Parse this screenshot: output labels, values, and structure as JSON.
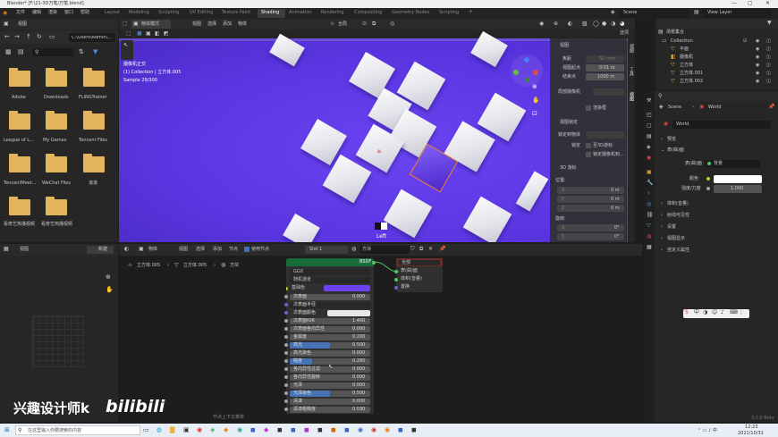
{
  "window": {
    "title": "Blender* [F:\\21-3D万笔/万笔.blend]"
  },
  "menu": [
    "文件",
    "编辑",
    "渲染",
    "窗口",
    "帮助"
  ],
  "workspaces": {
    "tabs": [
      "Layout",
      "Modeling",
      "Sculpting",
      "UV Editing",
      "Texture Paint",
      "Shading",
      "Animation",
      "Rendering",
      "Compositing",
      "Geometry Nodes",
      "Scripting"
    ],
    "active": "Shading",
    "plus": "+"
  },
  "topright": {
    "scene": "Scene",
    "view_layer": "View Layer"
  },
  "filebrowser": {
    "path": "C:\\Users\\Admin\\...",
    "view": "视图",
    "folders": [
      "Adobe",
      "Downloads",
      "FLiNGTrainer",
      "League of L...",
      "My Games",
      "Tencent Files",
      "TencentMeet...",
      "WeChat Files",
      "滚滚",
      "看奇艺热播视频",
      "看奇艺热播视频"
    ]
  },
  "viewport": {
    "mode": "物体模式",
    "menu": [
      "视图",
      "选择",
      "添加",
      "物体"
    ],
    "global": "全局",
    "options": "选项",
    "info": [
      "摄像机正交",
      "(1) Collection | 立方体.005",
      "Sample 29/300"
    ],
    "view_label": "Left"
  },
  "npanel": {
    "tabs": [
      "视图",
      "工具",
      "视图"
    ],
    "view_section": "视图",
    "focal_label": "焦距",
    "focal_value": "50 mm",
    "clip_start_label": "视图起点",
    "clip_start_value": "0.01 m",
    "clip_end_label": "结束点",
    "clip_end_value": "1000 m",
    "local_camera_label": "局部摄像机",
    "render_region": "渲染框",
    "lock_section": "视图锁定",
    "lock_object_label": "锁定到物体",
    "lock_label": "锁定",
    "lock_3d": "至3D游标",
    "lock_cam": "锁定摄像机到...",
    "cursor_section": "3D 游标",
    "location_label": "位置:",
    "rotation_label": "旋转:",
    "x_label": "X",
    "y_label": "Y",
    "z_label": "Z",
    "loc_x": "0 m",
    "loc_y": "0 m",
    "loc_z": "0 m",
    "rot_x": "0°",
    "rot_y": "0°"
  },
  "outliner": {
    "title": "场景集合",
    "items": [
      {
        "label": "Collection"
      },
      {
        "label": "平面"
      },
      {
        "label": "摄像机"
      },
      {
        "label": "立方体"
      },
      {
        "label": "立方体.001"
      },
      {
        "label": "立方体.002"
      }
    ]
  },
  "properties": {
    "scene_tab": "Scene",
    "world_tab": "World",
    "world_name": "World",
    "sections": [
      "预览",
      "表(曲)面",
      "体积(音量)",
      "射线可见性",
      "设置",
      "视图显示",
      "自定义属性"
    ],
    "surface_label": "表(曲)面",
    "surface_value": "背景",
    "color_label": "颜色",
    "strength_label": "强度/力度",
    "strength_value": "1.000",
    "version": "3.0.0 Beta"
  },
  "node_editor": {
    "menu": [
      "视图",
      "选择",
      "添加",
      "节点"
    ],
    "object_menu": "物体",
    "use_nodes": "使用节点",
    "new_label": "新建",
    "slot": "Slot 1",
    "material": "方块",
    "breadcrumb": [
      "立方体.005",
      "立方体.005",
      "方块"
    ],
    "bsdf_title": "BSDF",
    "bsdf_rows": [
      {
        "label": "GGX",
        "value": ""
      },
      {
        "label": "随机游走",
        "value": ""
      },
      {
        "label": "基础色",
        "value": ""
      },
      {
        "label": "次表面",
        "value": "0.000"
      },
      {
        "label": "次表面半径",
        "value": ""
      },
      {
        "label": "次表面颜色",
        "value": ""
      },
      {
        "label": "次表面IOR",
        "value": "1.400"
      },
      {
        "label": "次表面各向异性",
        "value": "0.000"
      },
      {
        "label": "金属度",
        "value": "0.200"
      },
      {
        "label": "高光",
        "value": "0.500"
      },
      {
        "label": "高光染色",
        "value": "0.000"
      },
      {
        "label": "糙度",
        "value": "0.280"
      },
      {
        "label": "各向异性过滤",
        "value": "0.000"
      },
      {
        "label": "各向异性旋转",
        "value": "0.000"
      },
      {
        "label": "光泽",
        "value": "0.000"
      },
      {
        "label": "光泽染色",
        "value": "0.500"
      },
      {
        "label": "清漆",
        "value": "0.000"
      },
      {
        "label": "清漆粗糙度",
        "value": "0.030"
      }
    ],
    "output_title": "全部",
    "output_rows": [
      "表(曲)面",
      "体积(音量)",
      "置换"
    ],
    "status_hint": "节点上下文菜单"
  },
  "watermark": {
    "text": "兴趣设计师k",
    "logo": "bilibili"
  },
  "taskbar": {
    "search_placeholder": "在这里输入你要搜索的内容",
    "time": "12:23",
    "date": "2021/10/31"
  },
  "colors": {
    "viewport_bg": "#5a35e0",
    "accent": "#4772b3",
    "selected_orange": "#f08030",
    "base_color": "#6e43ef"
  }
}
